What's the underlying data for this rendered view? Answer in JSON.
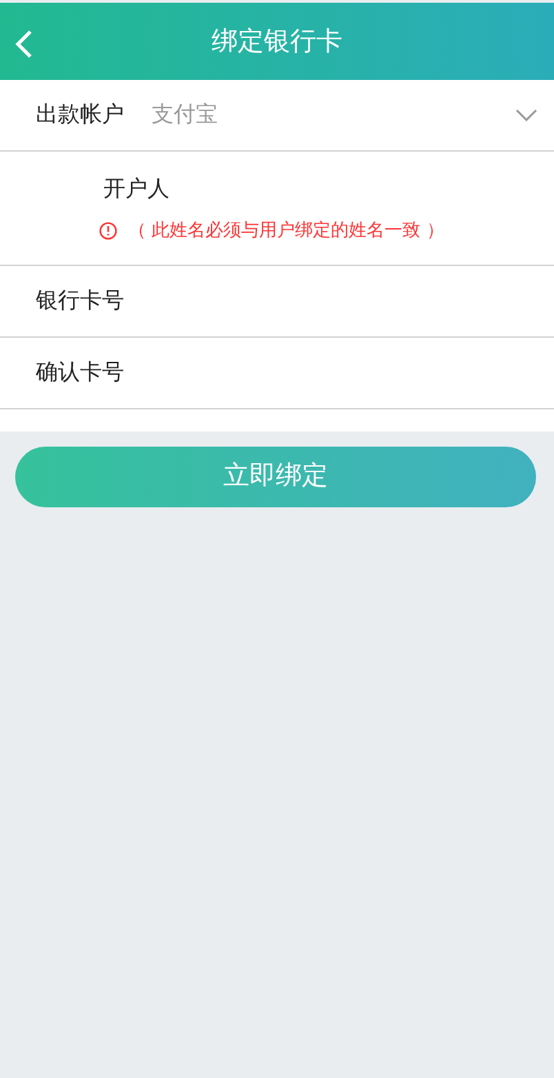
{
  "header": {
    "title": "绑定银行卡"
  },
  "fields": [
    {
      "kind": "select",
      "label": "出款帐户",
      "value": "支付宝"
    },
    {
      "kind": "text",
      "label": "开户人",
      "note": "（ 此姓名必须与用户绑定的姓名一致 ）"
    },
    {
      "kind": "text",
      "label": "银行卡号"
    },
    {
      "kind": "text",
      "label": "确认卡号"
    }
  ],
  "submit": {
    "label": "立即绑定"
  }
}
